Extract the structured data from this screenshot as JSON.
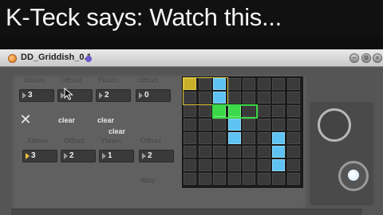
{
  "caption": {
    "text": "K-Teck says: Watch this..."
  },
  "window": {
    "title": "DD_Griddish_0.1"
  },
  "top_row": {
    "labels": [
      "Xlines",
      "Offset",
      "Ylines",
      "Offset"
    ],
    "values": [
      "3",
      "",
      "2",
      "0"
    ]
  },
  "buttons": {
    "clear_1": "clear",
    "clear_2": "clear",
    "clear_3": "clear",
    "x_label": "✕"
  },
  "bottom_row": {
    "labels": [
      "Xlines",
      "Offset",
      "Ylines",
      "Offset"
    ],
    "values": [
      "3",
      "2",
      "1",
      "2"
    ]
  },
  "footer_label": "Way",
  "grid": {
    "rows": 8,
    "cols": 8,
    "olive_cells": [
      [
        0,
        0
      ]
    ],
    "blue_cells": [
      [
        0,
        2
      ],
      [
        1,
        2
      ],
      [
        3,
        3
      ],
      [
        4,
        3
      ],
      [
        4,
        6
      ],
      [
        5,
        6
      ],
      [
        6,
        6
      ]
    ],
    "green_cells": [
      [
        2,
        2
      ],
      [
        2,
        3
      ]
    ]
  },
  "colors": {
    "blue": "#5ec3f2",
    "green": "#3dd84a",
    "olive": "#c8b02a"
  }
}
